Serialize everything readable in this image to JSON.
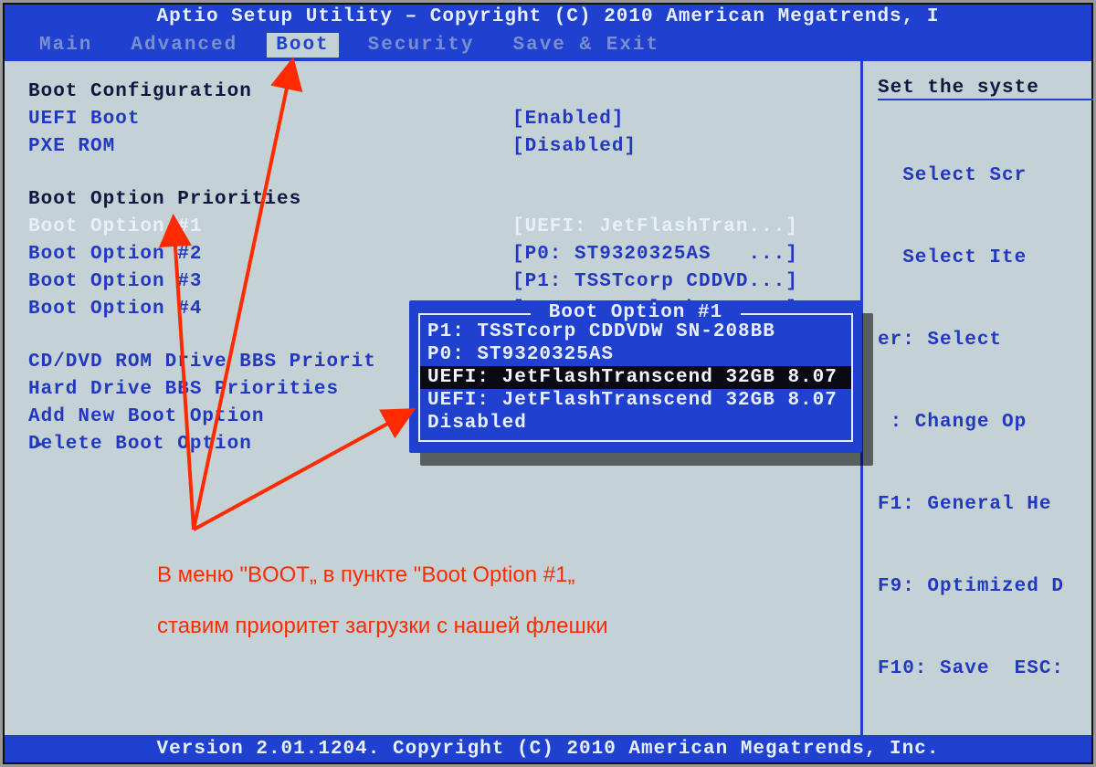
{
  "header": {
    "title": "Aptio Setup Utility – Copyright (C) 2010 American Megatrends, I",
    "footer": "Version 2.01.1204. Copyright (C) 2010 American Megatrends, Inc."
  },
  "menu": {
    "items": [
      "Main",
      "Advanced",
      "Boot",
      "Security",
      "Save & Exit"
    ],
    "active_index": 2
  },
  "left": {
    "section1_title": "Boot Configuration",
    "uefi_boot_label": "UEFI Boot",
    "uefi_boot_value": "[Enabled]",
    "pxe_rom_label": "PXE ROM",
    "pxe_rom_value": "[Disabled]",
    "section2_title": "Boot Option Priorities",
    "opt1_label": "Boot Option #1",
    "opt1_value": "[UEFI: JetFlashTran...]",
    "opt2_label": "Boot Option #2",
    "opt2_value": "[P0: ST9320325AS   ...]",
    "opt3_label": "Boot Option #3",
    "opt3_value": "[P1: TSSTcorp CDDVD...]",
    "opt4_label": "Boot Option #4",
    "opt4_value": "[UEFI: JetFlashTran...]",
    "cddvd_label": "CD/DVD ROM Drive BBS Priorit",
    "hdd_label": "Hard Drive BBS Priorities",
    "add_label": "Add New Boot Option",
    "del_label": "Delete Boot Option"
  },
  "side": {
    "desc": "Set the syste",
    "help": [
      "  Select Scr",
      "  Select Ite",
      "er: Select",
      " : Change Op",
      "F1: General He",
      "F9: Optimized D",
      "F10: Save  ESC:"
    ]
  },
  "popup": {
    "title": " Boot Option #1 ",
    "items": [
      "P1: TSSTcorp CDDVDW SN-208BB",
      "P0: ST9320325AS",
      "UEFI: JetFlashTranscend 32GB 8.07",
      "UEFI: JetFlashTranscend 32GB 8.07",
      "Disabled"
    ],
    "selected_index": 2
  },
  "annotation": {
    "line1": "В меню \"BOOT„ в пункте \"Boot Option #1„",
    "line2": "ставим приоритет загрузки с нашей флешки"
  }
}
